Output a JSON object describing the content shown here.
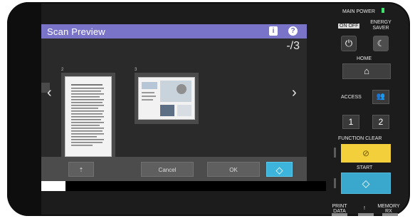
{
  "screen": {
    "title": "Scan Preview",
    "info_icon": "i",
    "help_icon": "?",
    "page_count": "-/3",
    "thumbnails": [
      {
        "number": "2"
      },
      {
        "number": "3"
      }
    ],
    "arrows": {
      "left": "‹",
      "right": "›"
    },
    "toolbar": {
      "extra_icon": "⇡",
      "cancel_label": "Cancel",
      "ok_label": "OK",
      "start_icon": "◇"
    }
  },
  "panel": {
    "main_power_label": "MAIN POWER",
    "on_off_label": "ON OFF",
    "energy_saver_label": "ENERGY SAVER",
    "power_icon": "⏻",
    "saver_icon": "☾",
    "home_label": "HOME",
    "home_icon": "⌂",
    "access_label": "ACCESS",
    "access_icon": "👥",
    "key1_label": "1",
    "key2_label": "2",
    "function_clear_label": "FUNCTION CLEAR",
    "function_clear_icon": "⊘",
    "start_label": "START",
    "start_icon": "◇",
    "print_data_label": "PRINT DATA",
    "memory_rx_label": "MEMORY RX",
    "separator_label": "!"
  },
  "colors": {
    "titlebar": "#7a74c8",
    "start_blue": "#3aa8cc",
    "function_clear_yellow": "#f3cf3b",
    "power_led": "#3fe26a"
  }
}
